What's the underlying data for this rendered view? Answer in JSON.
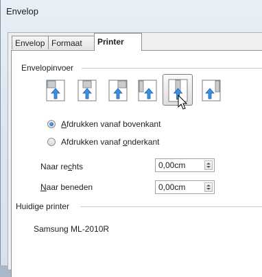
{
  "window": {
    "title": "Envelop"
  },
  "tabs": [
    {
      "label": "Envelop",
      "active": false
    },
    {
      "label": "Formaat",
      "active": false
    },
    {
      "label": "Printer",
      "active": true
    }
  ],
  "feed": {
    "legend": "Envelopinvoer",
    "options": [
      {
        "icon": "envelope-feed-horizontal-left-icon",
        "selected": false
      },
      {
        "icon": "envelope-feed-horizontal-center-icon",
        "selected": false
      },
      {
        "icon": "envelope-feed-horizontal-right-icon",
        "selected": false
      },
      {
        "icon": "envelope-feed-vertical-left-icon",
        "selected": false
      },
      {
        "icon": "envelope-feed-vertical-center-icon",
        "selected": true
      },
      {
        "icon": "envelope-feed-vertical-right-icon",
        "selected": false
      }
    ]
  },
  "print_side": {
    "top": {
      "pre": "",
      "key": "A",
      "post": "fdrukken vanaf bovenkant",
      "checked": true
    },
    "bottom": {
      "pre": "Afdrukken vanaf ",
      "key": "o",
      "post": "nderkant",
      "checked": false
    }
  },
  "shift": {
    "right": {
      "pre": "Naar re",
      "key": "c",
      "post": "hts",
      "value": "0,00cm"
    },
    "down": {
      "pre": "",
      "key": "N",
      "post": "aar beneden",
      "value": "0,00cm"
    }
  },
  "printer": {
    "legend": "Huidige printer",
    "name": "Samsung ML-2010R"
  },
  "colors": {
    "selection_border": "#7c7c7c",
    "radio_on": "#1e5fb0"
  }
}
